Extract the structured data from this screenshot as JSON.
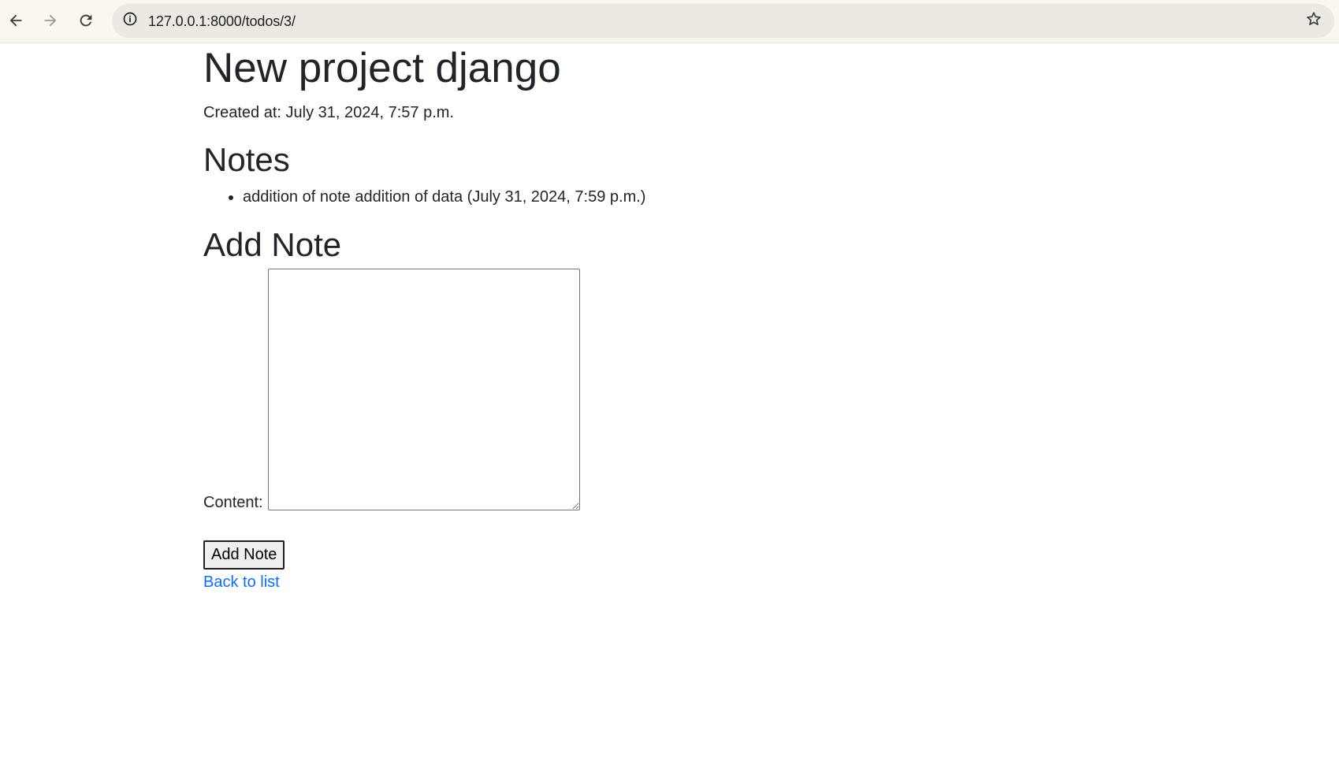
{
  "browser": {
    "url": "127.0.0.1:8000/todos/3/",
    "icons": {
      "back": "arrow-left-icon",
      "forward": "arrow-right-icon",
      "reload": "reload-icon",
      "site_info": "info-icon",
      "bookmark": "star-icon"
    }
  },
  "page": {
    "title": "New project django",
    "created_at": "Created at: July 31, 2024, 7:57 p.m.",
    "notes_heading": "Notes",
    "notes": [
      "addition of note addition of data (July 31, 2024, 7:59 p.m.)"
    ],
    "add_note_heading": "Add Note",
    "form": {
      "content_label": "Content:",
      "content_value": "",
      "submit_label": "Add Note"
    },
    "back_link": "Back to list"
  },
  "colors": {
    "link": "#0d6efd",
    "text": "#212529",
    "toolbar_bg": "#fbf7ef",
    "omnibox_bg": "#ece8e2"
  }
}
